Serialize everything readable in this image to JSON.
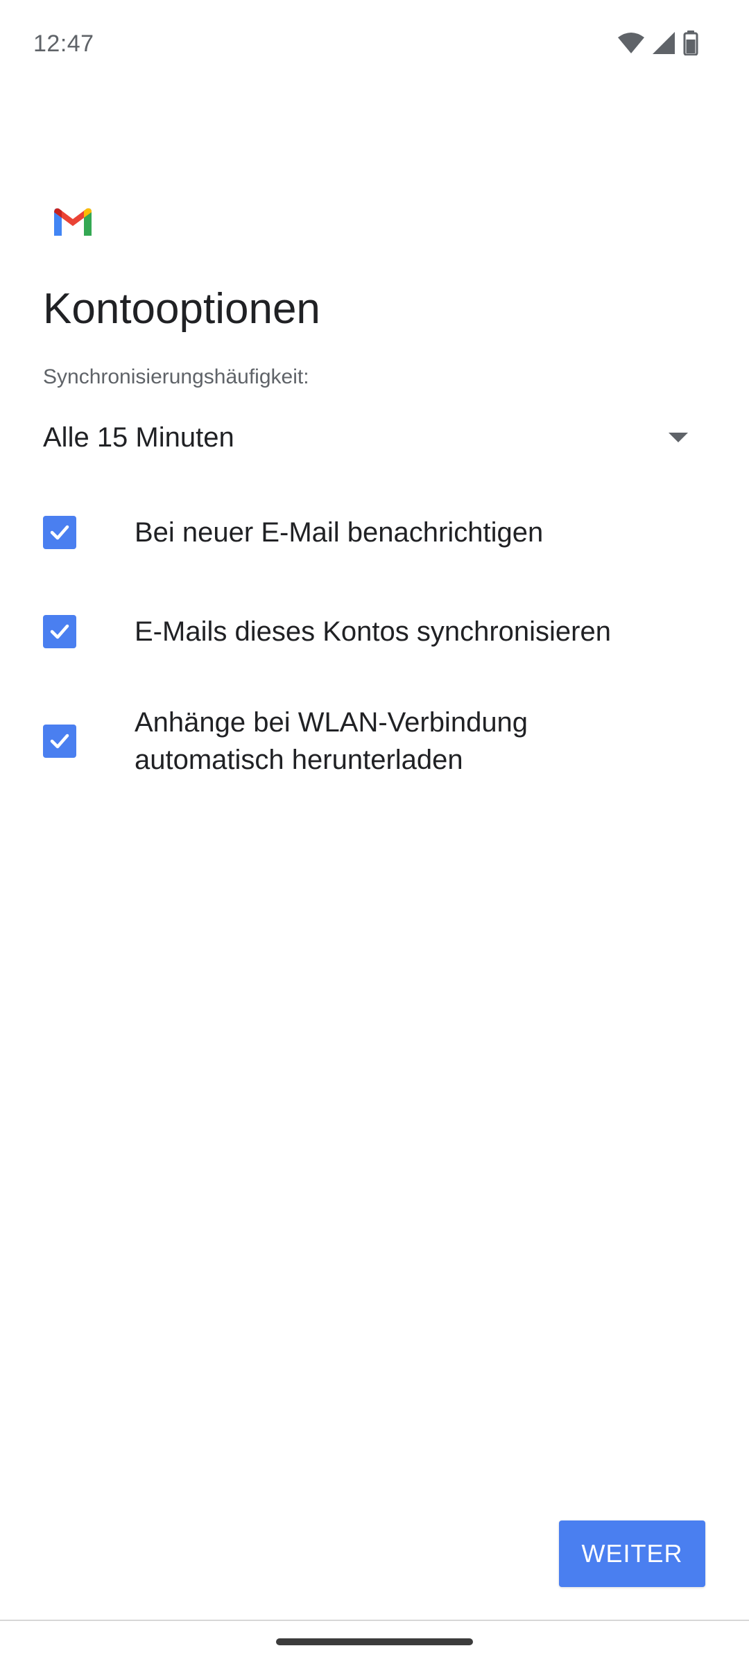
{
  "status_bar": {
    "time": "12:47",
    "icons": [
      "wifi-icon",
      "signal-icon",
      "battery-icon"
    ]
  },
  "app": {
    "logo": "gmail-logo"
  },
  "page": {
    "title": "Kontooptionen"
  },
  "sync": {
    "label": "Synchronisierungshäufigkeit:",
    "selected": "Alle 15 Minuten"
  },
  "options": [
    {
      "label": "Bei neuer E-Mail benachrichtigen",
      "checked": true
    },
    {
      "label": "E-Mails dieses Kontos synchronisieren",
      "checked": true
    },
    {
      "label": "Anhänge bei WLAN-Verbindung automatisch herunterladen",
      "checked": true
    }
  ],
  "actions": {
    "next_label": "WEITER"
  },
  "colors": {
    "accent": "#4a7ff0",
    "text_primary": "#202124",
    "text_secondary": "#5f6368"
  }
}
